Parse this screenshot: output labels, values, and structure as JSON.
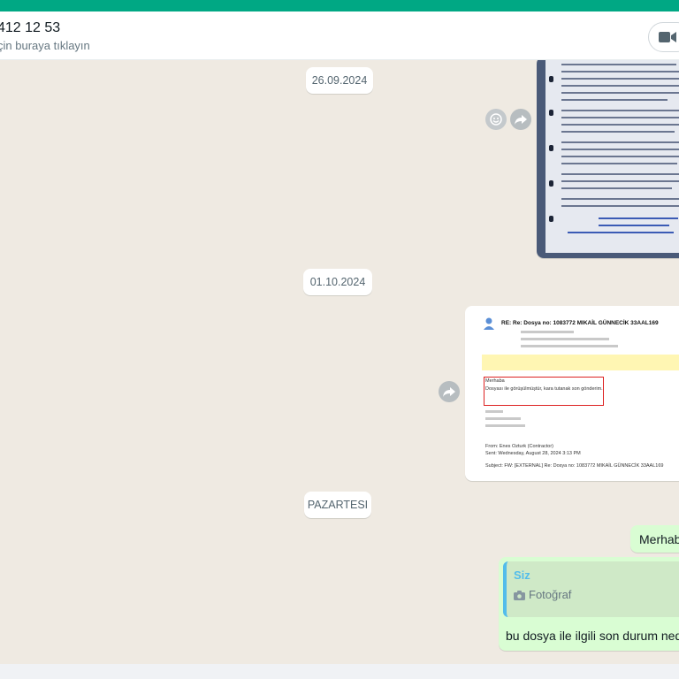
{
  "header": {
    "contact_name": "412 12 53",
    "subtitle": "çin buraya tıklayın"
  },
  "dates": {
    "d1": "26.09.2024",
    "d2": "01.10.2024",
    "d3": "PAZARTESI"
  },
  "email_preview": {
    "subject": "RE: Re: Dosya no: 1083772 MIKAİL GÜNNECİK 33AAL169",
    "body_line1": "Merhaba",
    "body_line2": "Dosyası ile görüşülmüştür, kara tutanak son gönderim.",
    "from_line": "From: Enes Ozturk (Contractor)",
    "sent_line": "Sent: Wednesday, August 28, 2024 3:13 PM",
    "subject_line": "Subject: FW: [EXTERNAL] Re: Dosya no: 1083772 MIKAİL GÜNNECİK 33AAL169"
  },
  "messages": {
    "m1": "Merhaba",
    "m2": "bu dosya ile ilgili son durum nedir"
  },
  "reply": {
    "sender": "Siz",
    "media_label": "Fotoğraf"
  },
  "colors": {
    "accent": "#00a884",
    "outgoing_bubble": "#d9fdd3",
    "quote_accent": "#53bdeb"
  },
  "icons": [
    "video-call-icon",
    "emoji-icon",
    "forward-icon",
    "camera-icon"
  ]
}
